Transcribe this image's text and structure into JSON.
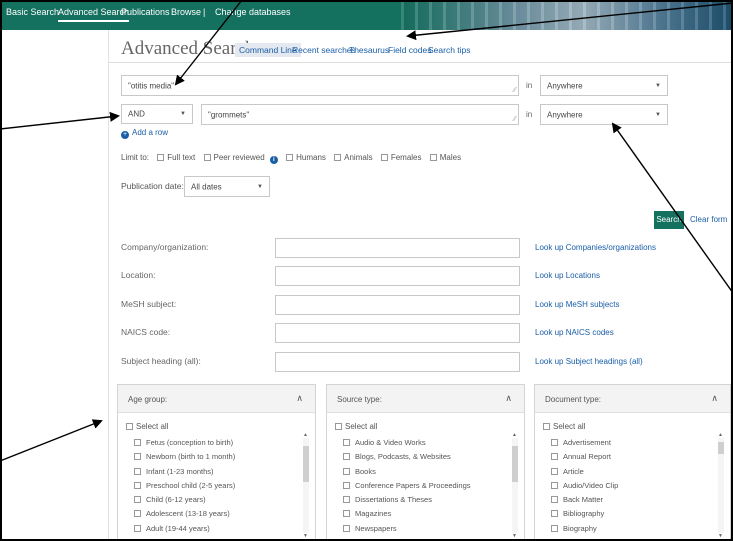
{
  "nav": {
    "items": [
      "Basic Search",
      "Advanced Search",
      "Publications",
      "Browse",
      "Change databases"
    ],
    "separator": "|",
    "active": "Advanced Search"
  },
  "page": {
    "title": "Advanced Search",
    "subtabs": [
      "Command Line",
      "Recent searches",
      "Thesaurus",
      "Field codes",
      "Search tips"
    ]
  },
  "query": {
    "row1": {
      "value": "\"otitis media\"",
      "in_label": "in",
      "field": "Anywhere"
    },
    "row2": {
      "operator": "AND",
      "value": "\"grommets\"",
      "in_label": "in",
      "field": "Anywhere"
    },
    "add_row": "Add a row"
  },
  "limits": {
    "label": "Limit to:",
    "options": [
      "Full text",
      "Peer reviewed",
      "Humans",
      "Animals",
      "Females",
      "Males"
    ]
  },
  "pubdate": {
    "label": "Publication date:",
    "value": "All dates"
  },
  "actions": {
    "search": "Search",
    "clear": "Clear form"
  },
  "fields": [
    {
      "label": "Company/organization:",
      "link": "Look up Companies/organizations"
    },
    {
      "label": "Location:",
      "link": "Look up Locations"
    },
    {
      "label": "MeSH subject:",
      "link": "Look up MeSH subjects"
    },
    {
      "label": "NAICS code:",
      "link": "Look up NAICS codes"
    },
    {
      "label": "Subject heading (all):",
      "link": "Look up Subject headings (all)"
    }
  ],
  "panels": [
    {
      "title": "Age group:",
      "select_all": "Select all",
      "items": [
        "Fetus (conception to birth)",
        "Newborn (birth to 1 month)",
        "Infant (1-23 months)",
        "Preschool child (2-5 years)",
        "Child (6-12 years)",
        "Adolescent (13-18 years)",
        "Adult (19-44 years)"
      ]
    },
    {
      "title": "Source type:",
      "select_all": "Select all",
      "items": [
        "Audio & Video Works",
        "Blogs, Podcasts, & Websites",
        "Books",
        "Conference Papers & Proceedings",
        "Dissertations & Theses",
        "Magazines",
        "Newspapers"
      ]
    },
    {
      "title": "Document type:",
      "select_all": "Select all",
      "items": [
        "Advertisement",
        "Annual Report",
        "Article",
        "Audio/Video Clip",
        "Back Matter",
        "Bibliography",
        "Biography"
      ]
    }
  ]
}
